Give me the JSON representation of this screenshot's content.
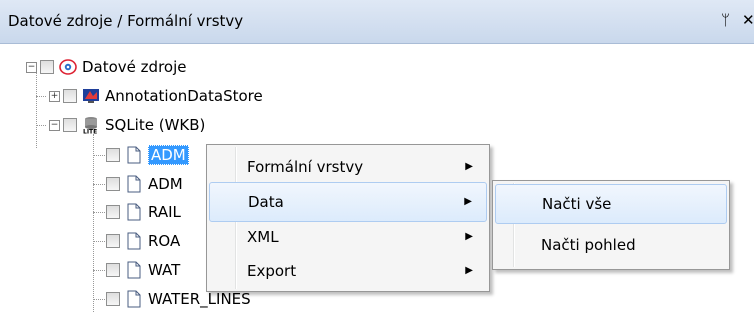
{
  "panel": {
    "title": "Datové zdroje / Formální vrstvy",
    "pin_glyph": "ᛘ",
    "close_glyph": "✕"
  },
  "tree": {
    "root": {
      "label": "Datové zdroje",
      "expander": "−",
      "icon": "datasource-eye-icon"
    },
    "stores": [
      {
        "label": "AnnotationDataStore",
        "expander": "+",
        "icon": "annotation-store-icon"
      },
      {
        "label": "SQLite (WKB)",
        "expander": "−",
        "icon": "sqlite-db-icon"
      }
    ],
    "layers": [
      {
        "label": "ADM",
        "selected": true
      },
      {
        "label": "ADM"
      },
      {
        "label": "RAIL"
      },
      {
        "label": "ROA"
      },
      {
        "label": "WAT"
      },
      {
        "label": "WATER_LINES"
      }
    ]
  },
  "context_menu": {
    "items": [
      {
        "label": "Formální vrstvy",
        "has_submenu": true
      },
      {
        "label": "Data",
        "has_submenu": true,
        "highlighted": true
      },
      {
        "label": "XML",
        "has_submenu": true
      },
      {
        "label": "Export",
        "has_submenu": true
      }
    ],
    "arrow_glyph": "▶"
  },
  "submenu": {
    "items": [
      {
        "label": "Načti vše",
        "highlighted": true
      },
      {
        "label": "Načti pohled"
      }
    ]
  },
  "colors": {
    "selection": "#3399ff",
    "header_top": "#dfe8f5",
    "header_bottom": "#c9d8ec",
    "menu_bg": "#f5f5f5",
    "menu_hover_border": "#aeccf1"
  }
}
